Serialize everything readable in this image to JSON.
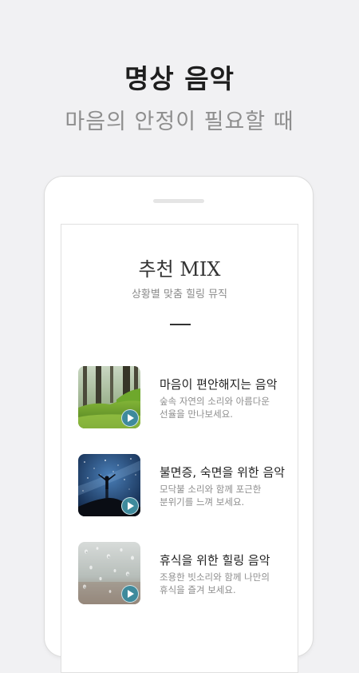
{
  "header": {
    "title": "명상 음악",
    "subtitle": "마음의 안정이 필요할 때"
  },
  "card": {
    "title": "추천 MIX",
    "subtitle": "상황별 맞춤 힐링 뮤직"
  },
  "items": [
    {
      "title": "마음이 편안해지는 음악",
      "desc_line1": "숲속 자연의 소리와 아름다운",
      "desc_line2": "선율을 만나보세요.",
      "icon": "play-icon"
    },
    {
      "title": "불면증, 숙면을 위한 음악",
      "desc_line1": "모닥불 소리와 함께 포근한",
      "desc_line2": "분위기를 느껴 보세요.",
      "icon": "play-icon"
    },
    {
      "title": "휴식을 위한 힐링 음악",
      "desc_line1": "조용한 빗소리와 함께 나만의",
      "desc_line2": "휴식을 즐겨 보세요.",
      "icon": "play-icon"
    }
  ],
  "colors": {
    "accent": "#3e8a9c",
    "background": "#f1f1f3"
  }
}
